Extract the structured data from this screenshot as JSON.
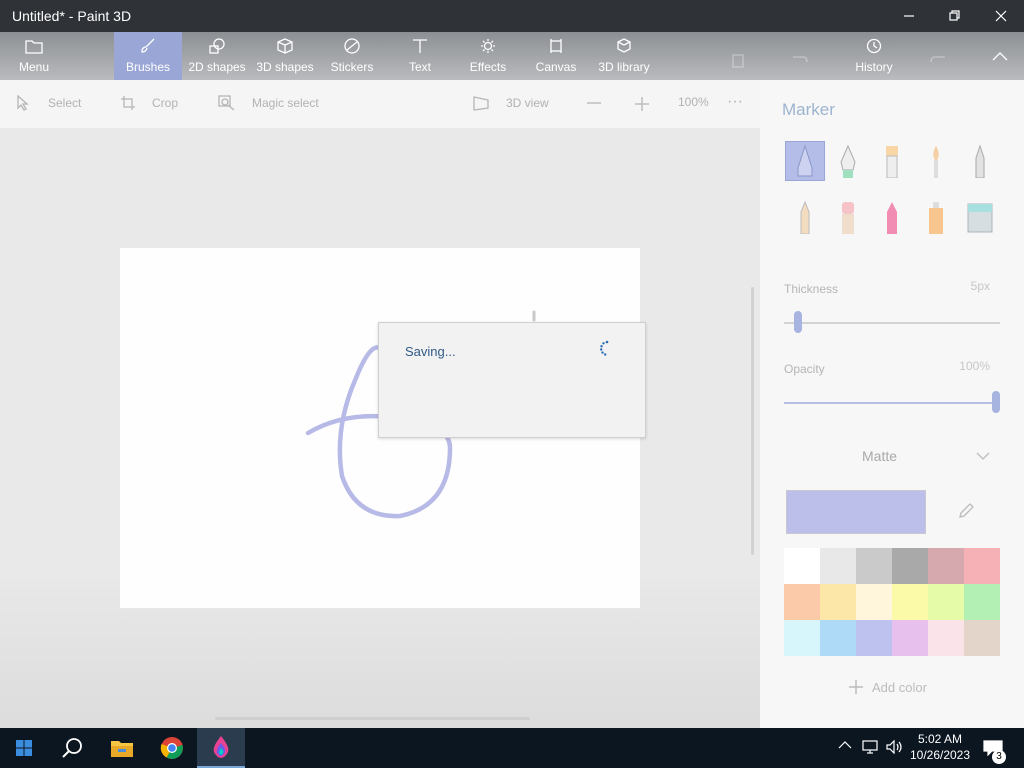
{
  "window": {
    "title": "Untitled* - Paint 3D"
  },
  "ribbon": {
    "items": [
      {
        "label": "Menu",
        "icon": "folder-icon"
      },
      {
        "label": "Brushes",
        "icon": "brush-icon"
      },
      {
        "label": "2D shapes",
        "icon": "shapes-icon"
      },
      {
        "label": "3D shapes",
        "icon": "cube-icon"
      },
      {
        "label": "Stickers",
        "icon": "sticker-icon"
      },
      {
        "label": "Text",
        "icon": "text-icon"
      },
      {
        "label": "Effects",
        "icon": "sun-icon"
      },
      {
        "label": "Canvas",
        "icon": "canvas-icon"
      },
      {
        "label": "3D library",
        "icon": "library-icon"
      },
      {
        "label": "History",
        "icon": "history-icon"
      }
    ],
    "active": "Brushes"
  },
  "toolbar": {
    "select_label": "Select",
    "crop_label": "Crop",
    "magic_select_label": "Magic select",
    "view3d_label": "3D view",
    "zoom_label": "100%",
    "more_label": "···"
  },
  "dialog": {
    "message": "Saving..."
  },
  "panel": {
    "title": "Marker",
    "brushes": [
      "marker",
      "calligraphy-pen",
      "oil-brush",
      "watercolor",
      "pixel-pen",
      "pencil",
      "eraser",
      "crayon",
      "spray-can",
      "fill"
    ],
    "thickness_label": "Thickness",
    "thickness_value": "5px",
    "thickness_level": 0.05,
    "opacity_label": "Opacity",
    "opacity_value": "100%",
    "opacity_level": 1.0,
    "finish_label": "Matte",
    "selected_color": "#bbbfea",
    "palette": [
      "#ffffff",
      "#e8e8e8",
      "#cacaca",
      "#a9a9a9",
      "#d6a9ae",
      "#f6b1b6",
      "#fbcaa9",
      "#fde7a8",
      "#fff6dc",
      "#fafaa8",
      "#e6fba8",
      "#b3f0b4",
      "#d7f6fb",
      "#aed9f7",
      "#bec2ee",
      "#e7c0ee",
      "#fbe3ea",
      "#e4d5cb"
    ],
    "add_color_label": "Add color"
  },
  "taskbar": {
    "apps": [
      "windows-start-icon",
      "search-icon",
      "file-explorer-icon",
      "chrome-icon",
      "paint3d-icon"
    ],
    "time": "5:02 AM",
    "date": "10/26/2023",
    "notification_count": "3"
  }
}
